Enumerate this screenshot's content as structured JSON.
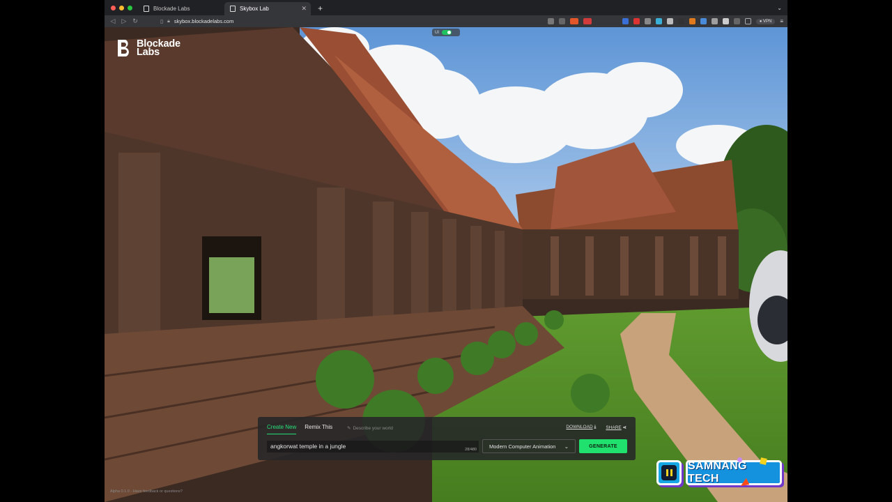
{
  "browser": {
    "tabs": [
      {
        "label": "Blockade Labs",
        "active": false
      },
      {
        "label": "Skybox Lab",
        "active": true
      }
    ],
    "new_tab_icon": "plus-icon",
    "url": "skybox.blockadelabs.com",
    "vpn_label": "VPN"
  },
  "app": {
    "logo_line1": "Blockade",
    "logo_line2": "Labs",
    "ui_toggle_label": "UI"
  },
  "panel": {
    "tabs": [
      {
        "label": "Create New",
        "active": true
      },
      {
        "label": "Remix This",
        "active": false
      }
    ],
    "describe_label": "Describe your world",
    "download_label": "DOWNLOAD",
    "share_label": "SHARE",
    "prompt_value": "angkorwat temple in a jungle",
    "char_count": "28/480",
    "style_value": "Modern Computer Animation",
    "generate_label": "GENERATE"
  },
  "footer": {
    "note": "Alpha 0.1.0 · Have feedback or questions?"
  },
  "overlay": {
    "channel_name": "SAMNANG TECH"
  },
  "colors": {
    "accent_green": "#20e06e",
    "badge_blue": "#1592dd",
    "badge_purple": "#7038c8"
  }
}
